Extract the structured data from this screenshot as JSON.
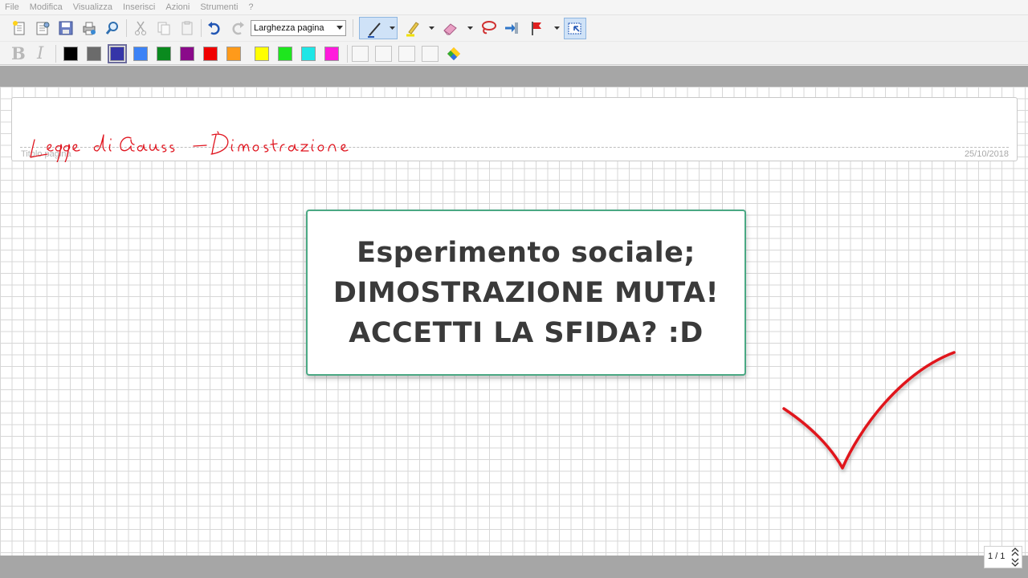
{
  "menu": [
    "File",
    "Modifica",
    "Visualizza",
    "Inserisci",
    "Azioni",
    "Strumenti",
    "?"
  ],
  "toolbar": {
    "zoom_value": "Larghezza pagina",
    "icons": [
      "new-page-icon",
      "open-icon",
      "save-icon",
      "print-icon",
      "search-icon",
      "cut-icon",
      "copy-icon",
      "paste-icon",
      "undo-icon",
      "redo-icon",
      "pen-icon",
      "highlighter-icon",
      "eraser-icon",
      "lasso-icon",
      "insert-icon",
      "flag-icon",
      "select-icon"
    ]
  },
  "format": {
    "bold_label": "B",
    "italic_label": "I",
    "colors": [
      "#000000",
      "#6b6b6b",
      "#3535a8",
      "#3b82f6",
      "#0a8a1e",
      "#8a0a8a",
      "#f00000",
      "#ff9a1a",
      "#ffff00",
      "#1ee61e",
      "#1ee6e6",
      "#ff1adc"
    ],
    "selected_color": "#3535a8"
  },
  "page": {
    "title_placeholder": "Titolo pagina",
    "date": "25/10/2018",
    "handwritten_title": "Legge di Gauss - Dimostrazione",
    "handwriting_color": "#e0141e",
    "callout": {
      "line1": "Esperimento sociale;",
      "line2": "DIMOSTRAZIONE MUTA!",
      "line3": "ACCETTI LA SFIDA? :D",
      "border_color": "#4aa883"
    },
    "checkmark_color": "#e0141e"
  },
  "pagination": {
    "label": "1 / 1"
  }
}
